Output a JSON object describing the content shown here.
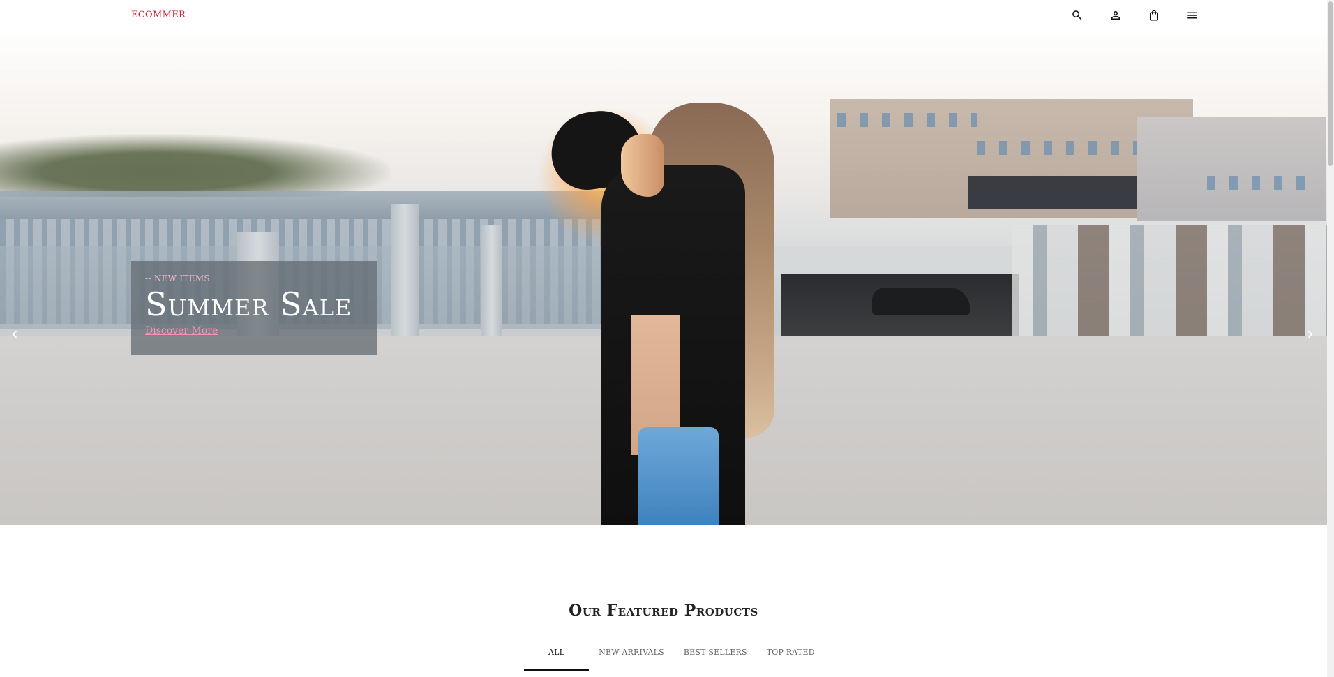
{
  "header": {
    "logo": "ECOMMER",
    "icons": [
      "search-icon",
      "user-icon",
      "shopping-bag-icon",
      "menu-icon"
    ]
  },
  "hero": {
    "kicker": "-- NEW ITEMS",
    "title": "Summer Sale",
    "link": "Discover More"
  },
  "featured": {
    "title_light": "Our Featured",
    "title_bold": "Products",
    "tabs": [
      "ALL",
      "NEW ARRIVALS",
      "BEST SELLERS",
      "TOP RATED"
    ],
    "active_tab": "ALL"
  },
  "colors": {
    "logo": "#d11f3b",
    "link": "#ff8fb4",
    "kicker": "#f4b7c6"
  }
}
